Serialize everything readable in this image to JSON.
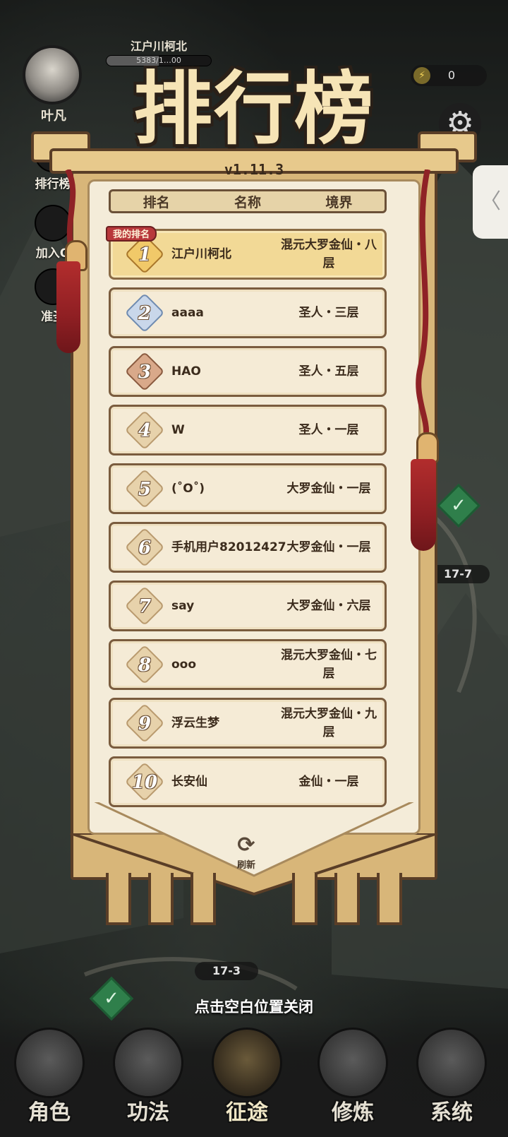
{
  "hud": {
    "player_label": "叶凡",
    "account_name": "江户川柯北",
    "exp_text": "5383/1…00",
    "exp_fraction": 0.5,
    "energy_value": "0",
    "side_buttons": [
      "排行榜",
      "加入Q",
      "准圣"
    ]
  },
  "banner": {
    "title": "排行榜",
    "version": "v1.11.3",
    "columns": [
      "排名",
      "名称",
      "境界"
    ],
    "my_rank_tag": "我的排名",
    "refresh_label": "刷新"
  },
  "my_rank": {
    "rank": "1",
    "name": "江户川柯北",
    "realm": "混元大罗金仙・八层"
  },
  "rows": [
    {
      "rank": "2",
      "name": "aaaa",
      "realm": "圣人・三层"
    },
    {
      "rank": "3",
      "name": "HAO",
      "realm": "圣人・五层"
    },
    {
      "rank": "4",
      "name": "W",
      "realm": "圣人・一层"
    },
    {
      "rank": "5",
      "name": "(˚O˚)",
      "realm": "大罗金仙・一层"
    },
    {
      "rank": "6",
      "name": "手机用户82012427",
      "realm": "大罗金仙・一层"
    },
    {
      "rank": "7",
      "name": "say",
      "realm": "大罗金仙・六层"
    },
    {
      "rank": "8",
      "name": "ooo",
      "realm": "混元大罗金仙・七层"
    },
    {
      "rank": "9",
      "name": "浮云生梦",
      "realm": "混元大罗金仙・九层"
    },
    {
      "rank": "10",
      "name": "长安仙",
      "realm": "金仙・一层"
    }
  ],
  "map": {
    "stage_right": "17-7",
    "stage_bottom": "17-3"
  },
  "close_hint": "点击空白位置关闭",
  "bottom_nav": [
    "角色",
    "功法",
    "征途",
    "修炼",
    "系统"
  ],
  "colors": {
    "gold_badge": "#f1c969",
    "silver_badge": "#c9d7ea",
    "bronze_badge": "#d9a98a",
    "tassel": "#b22d2d",
    "my_row": "#f2d996"
  }
}
